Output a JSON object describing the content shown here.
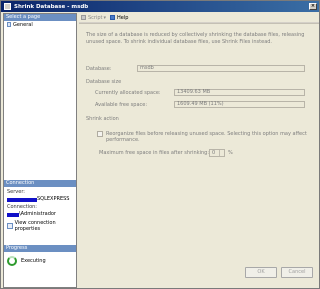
{
  "window": {
    "title": "Shrink Database - msdb",
    "close_glyph": "×"
  },
  "left_panel": {
    "select_page_header": "Select a page",
    "pages": [
      {
        "label": "General"
      }
    ],
    "connection_header": "Connection",
    "server_label": "Server:",
    "server_value_suffix": "SQLEXPRESS",
    "connection_label": "Connection:",
    "connection_value_suffix": "\\Administrador",
    "view_connection_properties": "View connection properties",
    "progress_header": "Progress",
    "progress_status": "Executing"
  },
  "toolbar": {
    "script_label": "Script",
    "help_label": "Help"
  },
  "content": {
    "description": "The size of a database is reduced by collectively shrinking the database files, releasing unused space. To shrink individual database files, use Shrink Files instead.",
    "database_label": "Database:",
    "database_value": "msdb",
    "database_size_header": "Database size",
    "allocated_label": "Currently allocated space:",
    "allocated_value": "13409.63 MB",
    "free_label": "Available free space:",
    "free_value": "1609.49 MB (11%)",
    "shrink_action_header": "Shrink action",
    "reorganize_label": "Reorganize files before releasing unused space. Selecting this option may affect performance.",
    "reorganize_checked": false,
    "max_free_label": "Maximum free space in files after shrinking:",
    "max_free_value": "0",
    "max_free_unit": "%"
  },
  "footer": {
    "ok_label": "OK",
    "cancel_label": "Cancel"
  }
}
